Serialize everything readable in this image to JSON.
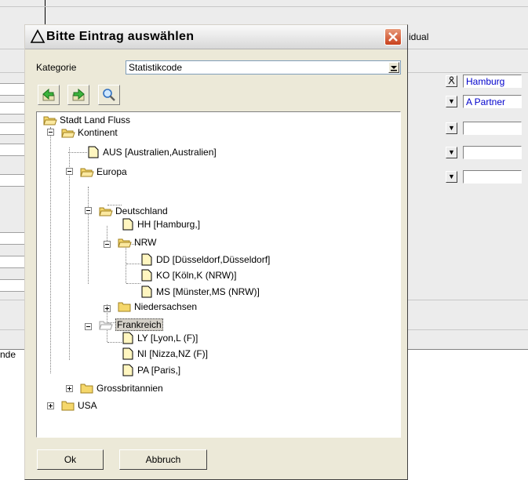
{
  "background": {
    "label_right": "idual",
    "label_left": "nde",
    "fields": [
      "Hamburg",
      "A Partner",
      "",
      "",
      ""
    ]
  },
  "dialog": {
    "title": "Bitte Eintrag auswählen",
    "category_label": "Kategorie",
    "category_value": "Statistikcode",
    "ok_label": "Ok",
    "cancel_label": "Abbruch"
  },
  "tree": {
    "root": "Stadt Land Fluss",
    "kontinent": "Kontinent",
    "aus": "AUS [Australien,Australien]",
    "europa": "Europa",
    "deutschland": "Deutschland",
    "hh": "HH [Hamburg,]",
    "nrw": "NRW",
    "dd": "DD [Düsseldorf,Düsseldorf]",
    "ko": "KO [Köln,K (NRW)]",
    "ms": "MS [Münster,MS (NRW)]",
    "niedersachsen": "Niedersachsen",
    "frankreich": "Frankreich",
    "ly": "LY [Lyon,L (F)]",
    "ni": "NI [Nizza,NZ (F)]",
    "pa": "PA [Paris,]",
    "grossbritannien": "Grossbritannien",
    "usa": "USA"
  },
  "colors": {
    "folder": "#f5d76b",
    "link_text": "#0000cc"
  }
}
